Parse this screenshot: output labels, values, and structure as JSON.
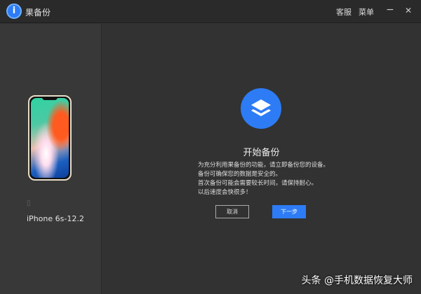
{
  "app": {
    "title": "果备份",
    "logo_letter": "i"
  },
  "titlebar": {
    "support": "客服",
    "menu": "菜单",
    "minimize": "−",
    "close": "✕"
  },
  "device": {
    "name": "iPhone 6s-12.2",
    "icon": "device-icon"
  },
  "main": {
    "heading": "开始备份",
    "lines": [
      "为充分利用果备份的功能，请立即备份您的设备。",
      "备份可确保您的数据是安全的。",
      "首次备份可能会需要较长时间，请保持耐心。",
      "以后速度会快很多！"
    ],
    "cancel": "取消",
    "next": "下一步"
  },
  "watermark": "头条 @手机数据恢复大师",
  "colors": {
    "accent": "#2d7cf6"
  }
}
